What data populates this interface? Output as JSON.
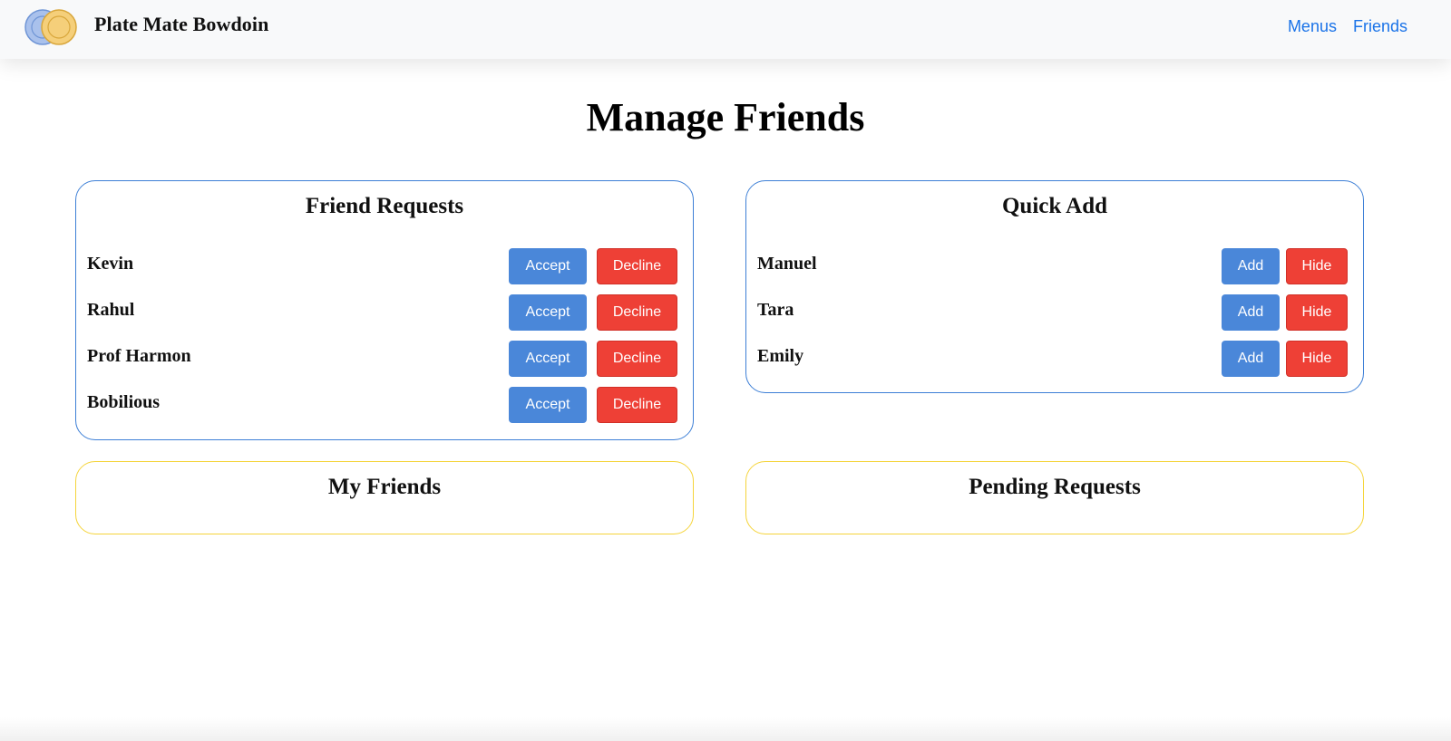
{
  "navbar": {
    "brand": "Plate Mate Bowdoin",
    "links": [
      "Menus",
      "Friends"
    ]
  },
  "page": {
    "title": "Manage Friends"
  },
  "friend_requests": {
    "title": "Friend Requests",
    "accept_label": "Accept",
    "decline_label": "Decline",
    "items": [
      "Kevin",
      "Rahul",
      "Prof Harmon",
      "Bobilious"
    ]
  },
  "quick_add": {
    "title": "Quick Add",
    "add_label": "Add",
    "hide_label": "Hide",
    "items": [
      "Manuel",
      "Tara",
      "Emily"
    ]
  },
  "my_friends": {
    "title": "My Friends"
  },
  "pending_requests": {
    "title": "Pending Requests"
  },
  "colors": {
    "primary_button": "#4a87d9",
    "danger_button": "#ee4036",
    "card_border_blue": "#3d7fd6",
    "card_border_yellow": "#f5d43a",
    "link": "#1a73e8"
  }
}
